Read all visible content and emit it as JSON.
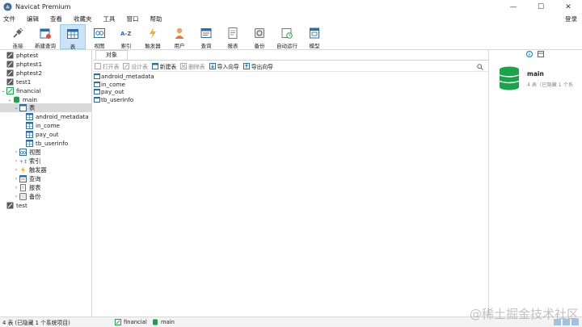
{
  "window": {
    "title": "Navicat Premium"
  },
  "menu": {
    "items": [
      "文件",
      "编辑",
      "查看",
      "收藏夹",
      "工具",
      "窗口",
      "帮助"
    ],
    "login": "登录"
  },
  "toolbar": {
    "buttons": [
      {
        "label": "连接",
        "icon": "plug-icon"
      },
      {
        "label": "新建查询",
        "icon": "new-query-icon"
      },
      {
        "label": "表",
        "icon": "table-icon"
      },
      {
        "label": "视图",
        "icon": "view-icon"
      },
      {
        "label": "索引",
        "icon": "index-icon"
      },
      {
        "label": "触发器",
        "icon": "lightning-icon"
      },
      {
        "label": "用户",
        "icon": "user-icon"
      },
      {
        "label": "查询",
        "icon": "query-icon"
      },
      {
        "label": "报表",
        "icon": "report-icon"
      },
      {
        "label": "备份",
        "icon": "backup-icon"
      },
      {
        "label": "自动运行",
        "icon": "schedule-icon"
      },
      {
        "label": "模型",
        "icon": "model-icon"
      }
    ],
    "active_index": 2
  },
  "tree": {
    "connections": [
      "phptest",
      "phptest1",
      "phptest2",
      "test1",
      "financial"
    ],
    "database": "main",
    "tables_label": "表",
    "tables": [
      "android_metadata",
      "in_come",
      "pay_out",
      "tb_userinfo"
    ],
    "groups": [
      "视图",
      "索引",
      "触发器",
      "查询",
      "报表",
      "备份"
    ],
    "last_connection": "test"
  },
  "center": {
    "tab": "对象",
    "actions": [
      "打开表",
      "设计表",
      "新建表",
      "删除表",
      "导入向导",
      "导出向导"
    ],
    "tables": [
      "android_metadata",
      "in_come",
      "pay_out",
      "tb_userinfo"
    ]
  },
  "details": {
    "name": "main",
    "desc": "4 表（已隐藏 1 个系"
  },
  "status": {
    "count": "4 表 (已隐藏 1 个系统项目)",
    "connection": "financial",
    "database": "main"
  },
  "watermark": "@稀土掘金技术社区",
  "colors": {
    "accent": "#0078d7",
    "db_green": "#1aa34a",
    "table_blue": "#2b6cb0",
    "active_bg": "#cce4f7"
  }
}
